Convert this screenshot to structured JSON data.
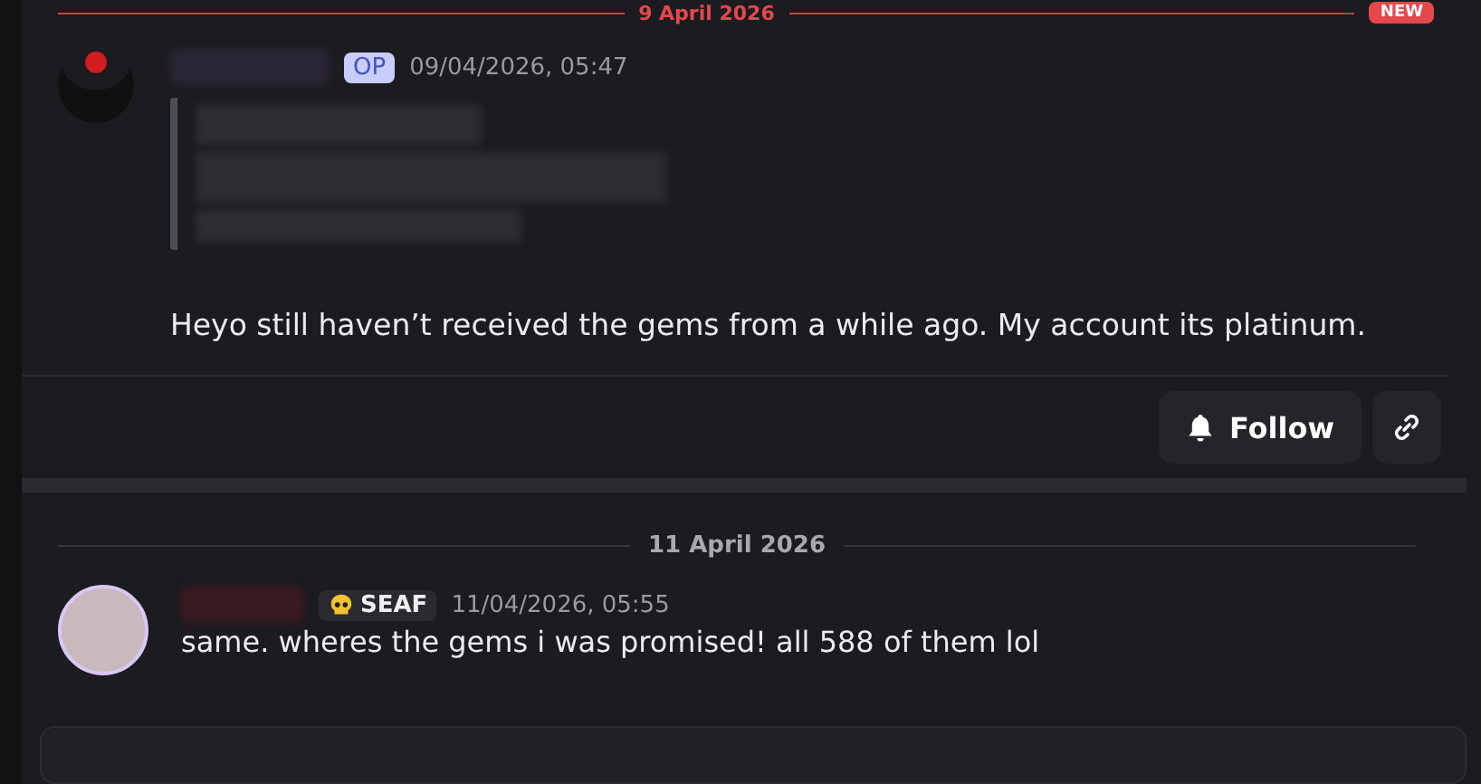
{
  "top_divider": {
    "date": "9 April 2026",
    "badge": "NEW"
  },
  "post": {
    "op_badge": "OP",
    "timestamp": "09/04/2026, 05:47",
    "text": "Heyo still haven’t received the gems from a while ago. My account its platinum.",
    "follow_button": "Follow"
  },
  "date_divider": "11 April 2026",
  "reply": {
    "tag": "SEAF",
    "timestamp": "11/04/2026, 05:55",
    "text": "same. wheres the gems i was promised! all 588 of them lol"
  }
}
